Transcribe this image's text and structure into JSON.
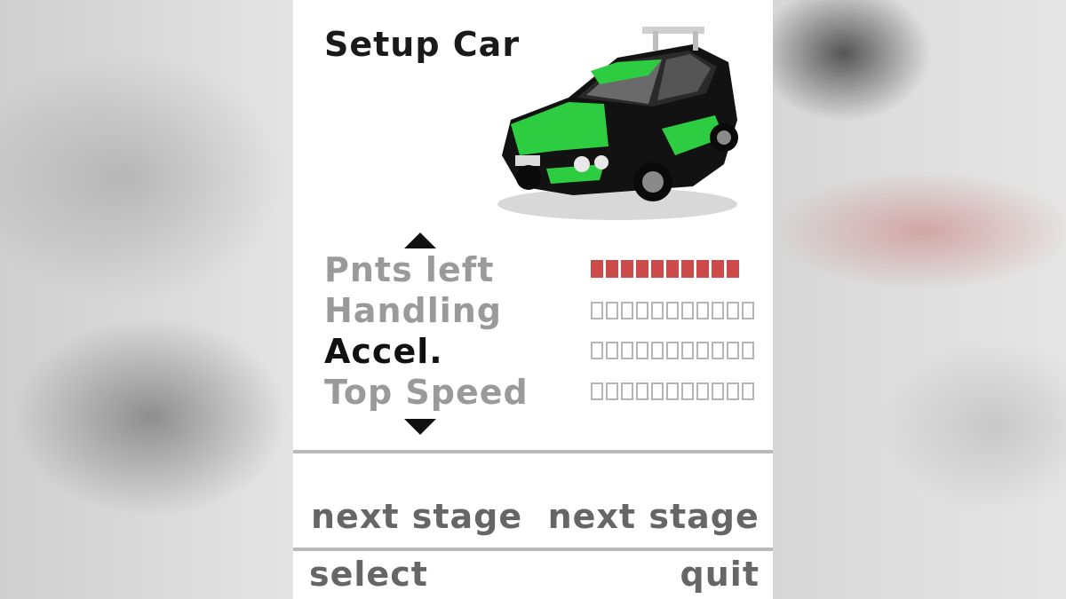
{
  "screen": {
    "title": "Setup Car"
  },
  "stats": [
    {
      "label": "Pnts left",
      "filled": 10,
      "total": 10,
      "active": false
    },
    {
      "label": "Handling",
      "filled": 0,
      "total": 11,
      "active": false
    },
    {
      "label": "Accel.",
      "filled": 0,
      "total": 11,
      "active": true
    },
    {
      "label": "Top Speed",
      "filled": 0,
      "total": 11,
      "active": false
    }
  ],
  "ticker_text": "next stage  next stage  next",
  "softkeys": {
    "left": "select",
    "right": "quit"
  },
  "icons": {
    "scroll_up": "arrow-up-icon",
    "scroll_down": "arrow-down-icon",
    "car": "rally-car-image"
  },
  "colors": {
    "points_bar": "#cc4a4a",
    "empty_segment": "#b5b5b5",
    "active_label": "#111111",
    "inactive_label": "#9a9a9a",
    "car_livery": "#2ecc40"
  }
}
